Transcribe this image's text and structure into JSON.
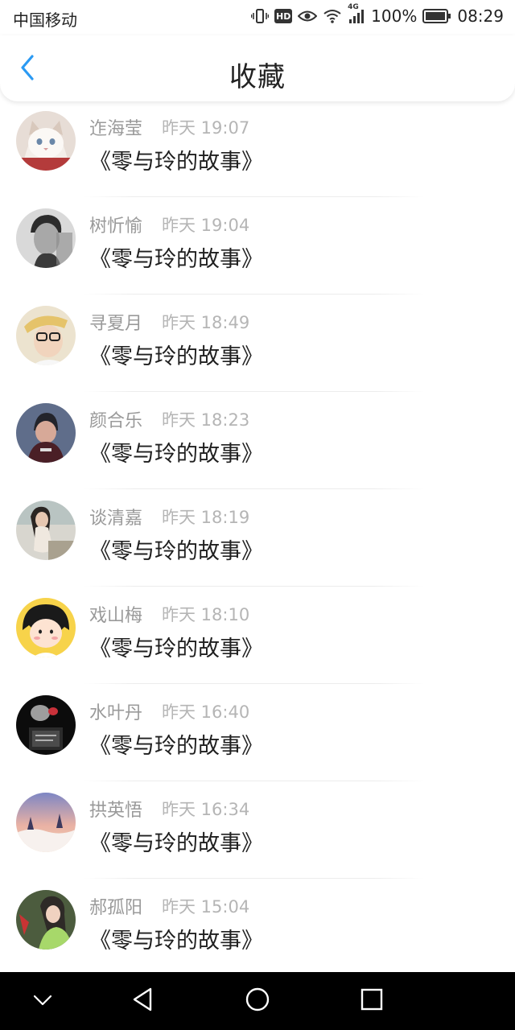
{
  "status_bar": {
    "carrier": "中国移动",
    "hd_label": "HD",
    "network_label": "4G",
    "battery": "100%",
    "time": "08:29"
  },
  "nav": {
    "title": "收藏",
    "back_icon": "chevron-left-icon",
    "accent_color": "#2b9af3"
  },
  "favorites": [
    {
      "name": "迮海莹",
      "time": "昨天 19:07",
      "content": "《零与玲的故事》"
    },
    {
      "name": "树忻愉",
      "time": "昨天 19:04",
      "content": "《零与玲的故事》"
    },
    {
      "name": "寻夏月",
      "time": "昨天 18:49",
      "content": "《零与玲的故事》"
    },
    {
      "name": "颜合乐",
      "time": "昨天 18:23",
      "content": "《零与玲的故事》"
    },
    {
      "name": "谈清嘉",
      "time": "昨天 18:19",
      "content": "《零与玲的故事》"
    },
    {
      "name": "戏山梅",
      "time": "昨天 18:10",
      "content": "《零与玲的故事》"
    },
    {
      "name": "水叶丹",
      "time": "昨天 16:40",
      "content": "《零与玲的故事》"
    },
    {
      "name": "拱英悟",
      "time": "昨天 16:34",
      "content": "《零与玲的故事》"
    },
    {
      "name": "郝孤阳",
      "time": "昨天 15:04",
      "content": "《零与玲的故事》"
    }
  ],
  "system_nav": {
    "buttons": [
      "chevron-down-icon",
      "back-triangle-icon",
      "home-circle-icon",
      "recents-square-icon"
    ]
  }
}
